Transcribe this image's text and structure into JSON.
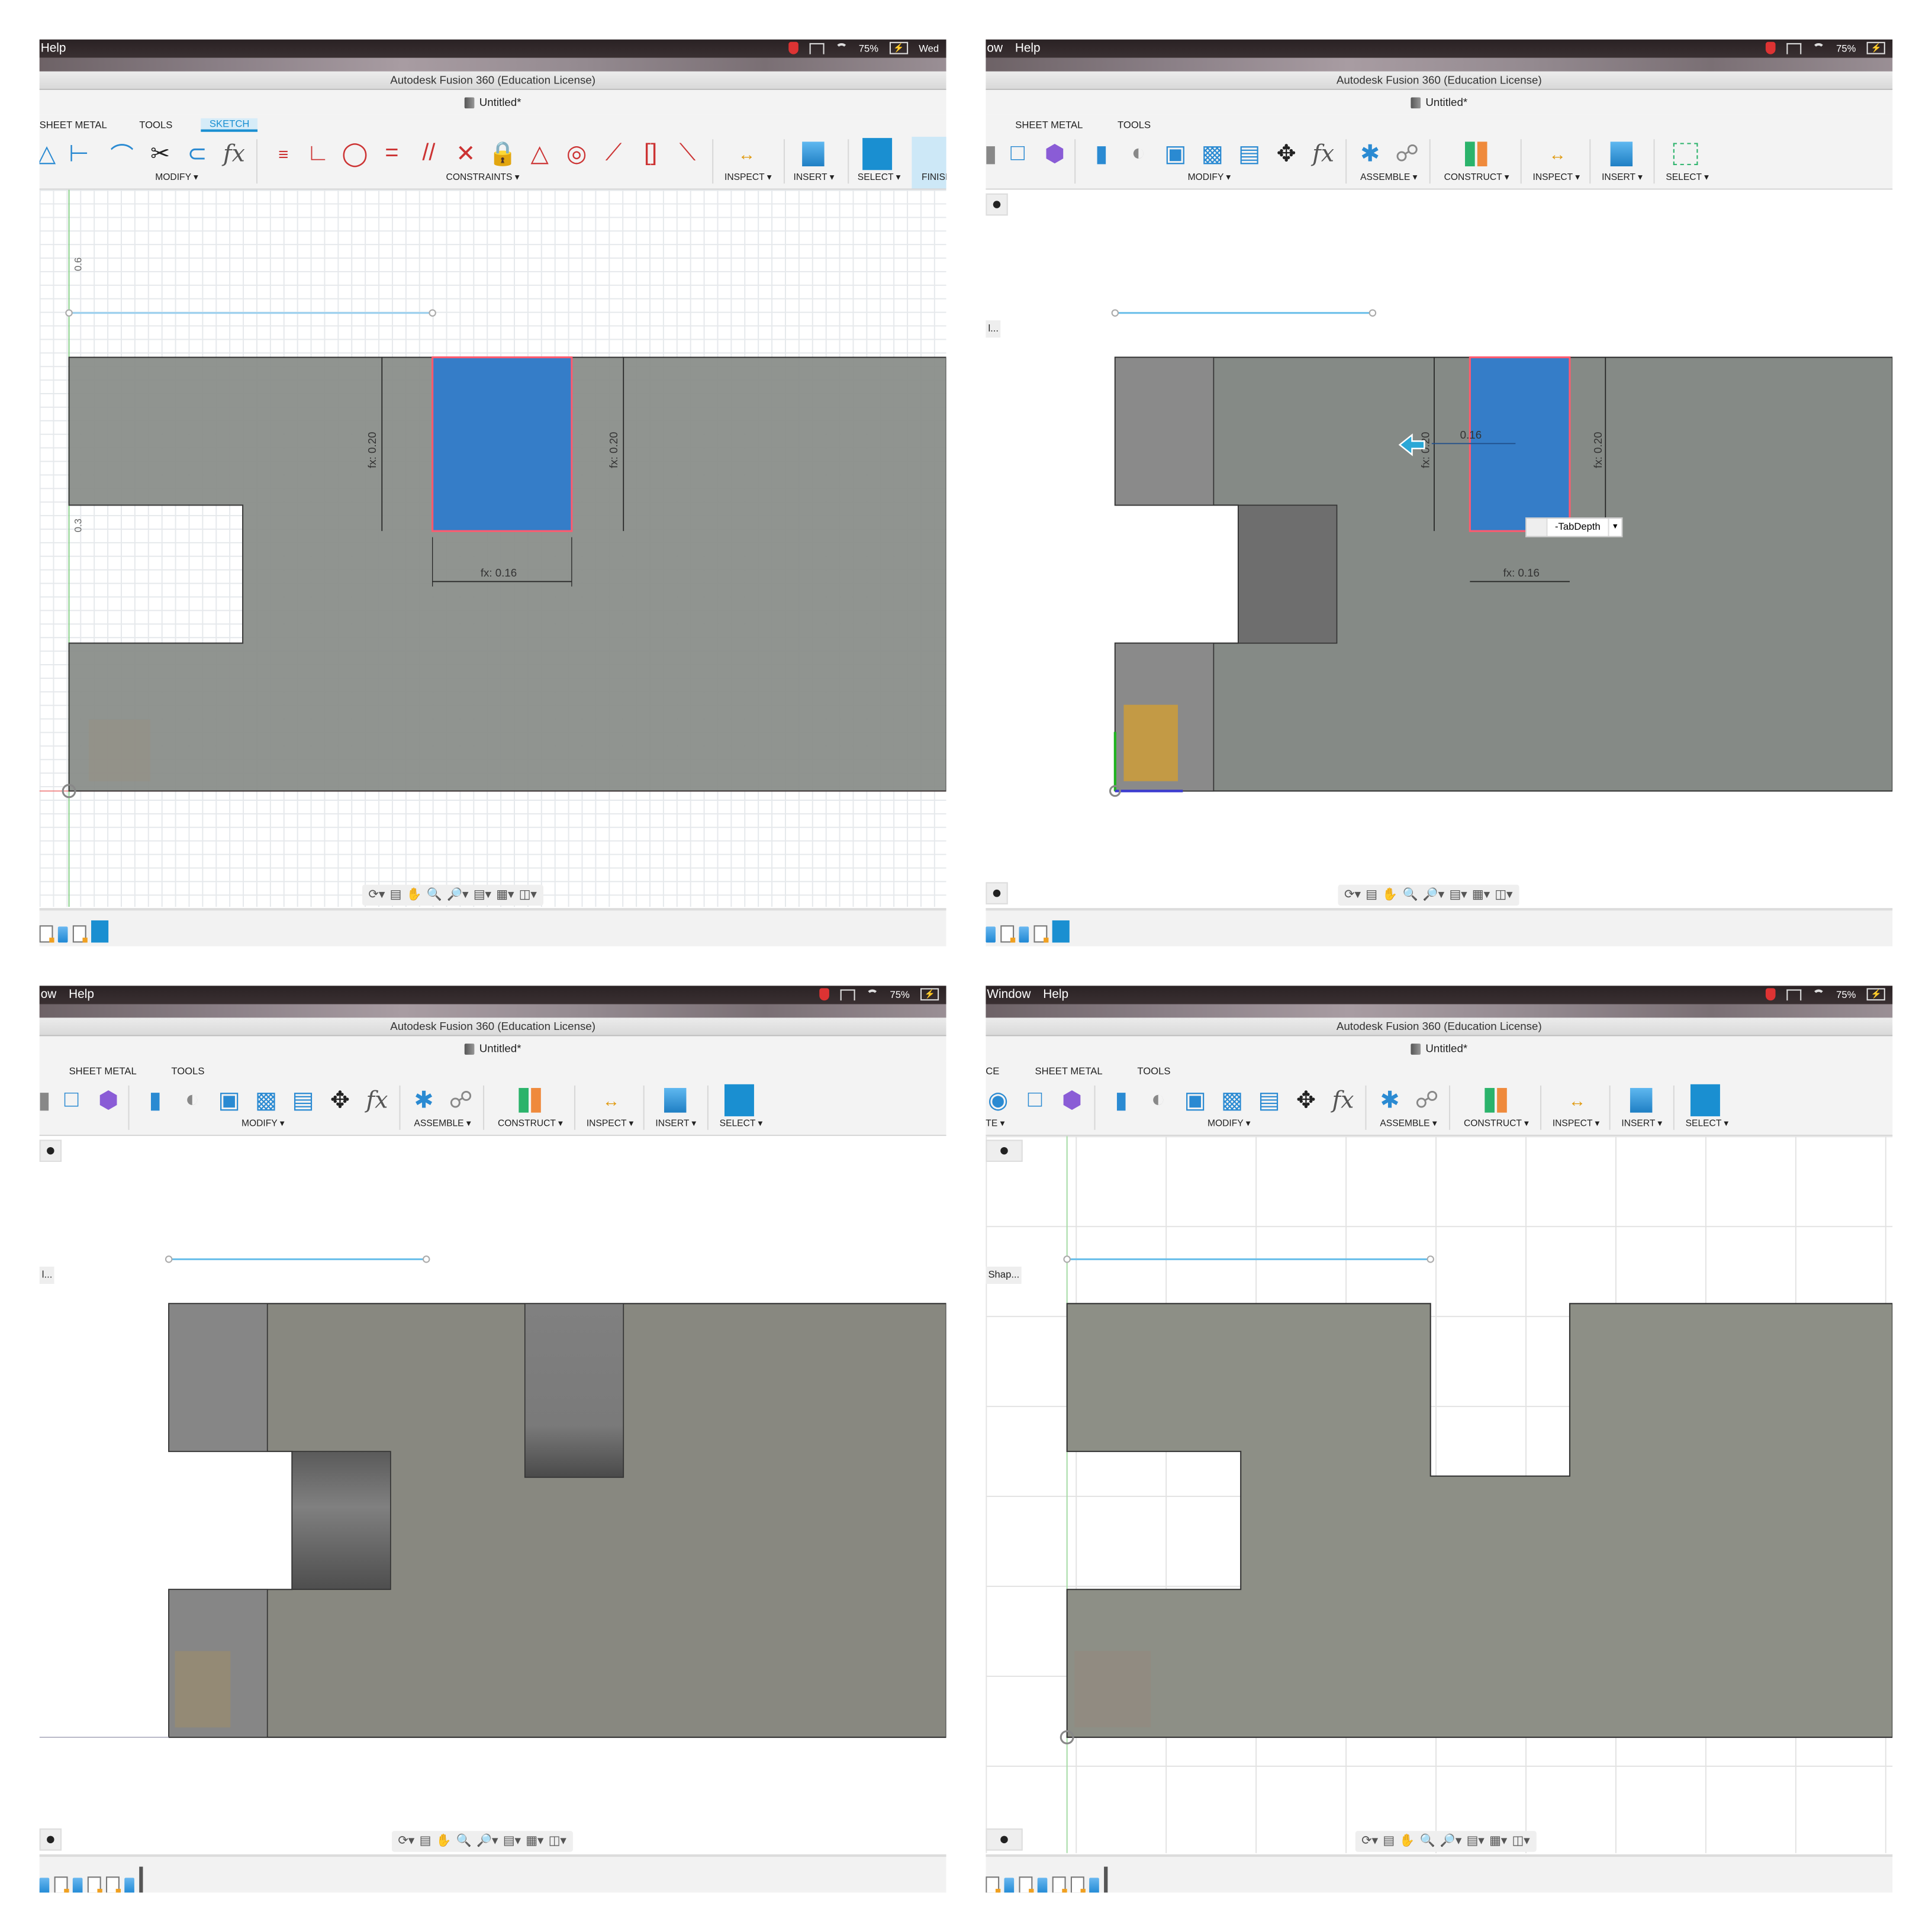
{
  "app": {
    "window_title": "Autodesk Fusion 360 (Education License)",
    "document_title": "Untitled*",
    "accent_color": "#1a8fd1",
    "body_color": "#8a8c86",
    "selected_profile_color": "#357dc8"
  },
  "panels": [
    {
      "id": "top-left",
      "menubar": {
        "items": [
          "Help"
        ],
        "battery": "75%",
        "clock": "Wed"
      },
      "ribbon_tabs": [
        {
          "label": "SHEET METAL"
        },
        {
          "label": "TOOLS"
        },
        {
          "label": "SKETCH",
          "active": true
        }
      ],
      "groups": [
        "MODIFY ▾",
        "CONSTRAINTS ▾",
        "INSPECT ▾",
        "INSERT ▾",
        "SELECT ▾",
        "FINISH"
      ],
      "dimensions": {
        "left_height": "fx: 0.20",
        "right_height": "fx: 0.20",
        "width": "fx: 0.16"
      },
      "ruler_labels": [
        "0.6",
        "0.3"
      ]
    },
    {
      "id": "top-right",
      "menubar": {
        "items": [
          "ow",
          "Help"
        ],
        "battery": "75%"
      },
      "ribbon_tabs": [
        {
          "label": "SHEET METAL"
        },
        {
          "label": "TOOLS"
        }
      ],
      "groups": [
        "MODIFY ▾",
        "ASSEMBLE ▾",
        "CONSTRUCT ▾",
        "INSPECT ▾",
        "INSERT ▾",
        "SELECT ▾"
      ],
      "dimensions": {
        "left_height": "fx: 0.20",
        "right_height": "fx: 0.20",
        "width": "fx: 0.16",
        "drag_value": "0.16"
      },
      "extrude_input": {
        "value": "-TabDepth"
      },
      "browser_label": "l..."
    },
    {
      "id": "bottom-left",
      "menubar": {
        "items": [
          "ow",
          "Help"
        ],
        "battery": "75%"
      },
      "ribbon_tabs": [
        {
          "label": "SHEET METAL"
        },
        {
          "label": "TOOLS"
        }
      ],
      "groups": [
        "MODIFY ▾",
        "ASSEMBLE ▾",
        "CONSTRUCT ▾",
        "INSPECT ▾",
        "INSERT ▾",
        "SELECT ▾"
      ],
      "browser_label": "l..."
    },
    {
      "id": "bottom-right",
      "menubar": {
        "items": [
          "Window",
          "Help"
        ],
        "battery": "75%"
      },
      "ribbon_tabs": [
        {
          "label": "CE"
        },
        {
          "label": "SHEET METAL"
        },
        {
          "label": "TOOLS"
        }
      ],
      "groups": [
        "TE ▾",
        "MODIFY ▾",
        "ASSEMBLE ▾",
        "CONSTRUCT ▾",
        "INSPECT ▾",
        "INSERT ▾",
        "SELECT ▾"
      ],
      "browser_label": "Shap..."
    }
  ],
  "icons": {
    "nav_bar": [
      "orbit-icon",
      "look-at-icon",
      "pan-hand-icon",
      "zoom-icon",
      "fit-icon",
      "display-settings-icon",
      "grid-icon",
      "viewports-icon"
    ],
    "sketch_modify": [
      "fillet-icon",
      "trim-icon",
      "offset-icon",
      "fx-parameters-icon"
    ],
    "constraints": [
      "horizontal-vertical",
      "coincident",
      "tangent",
      "equal",
      "parallel",
      "perpendicular",
      "fix-lock",
      "midpoint",
      "concentric",
      "collinear",
      "symmetry",
      "curvature"
    ]
  }
}
